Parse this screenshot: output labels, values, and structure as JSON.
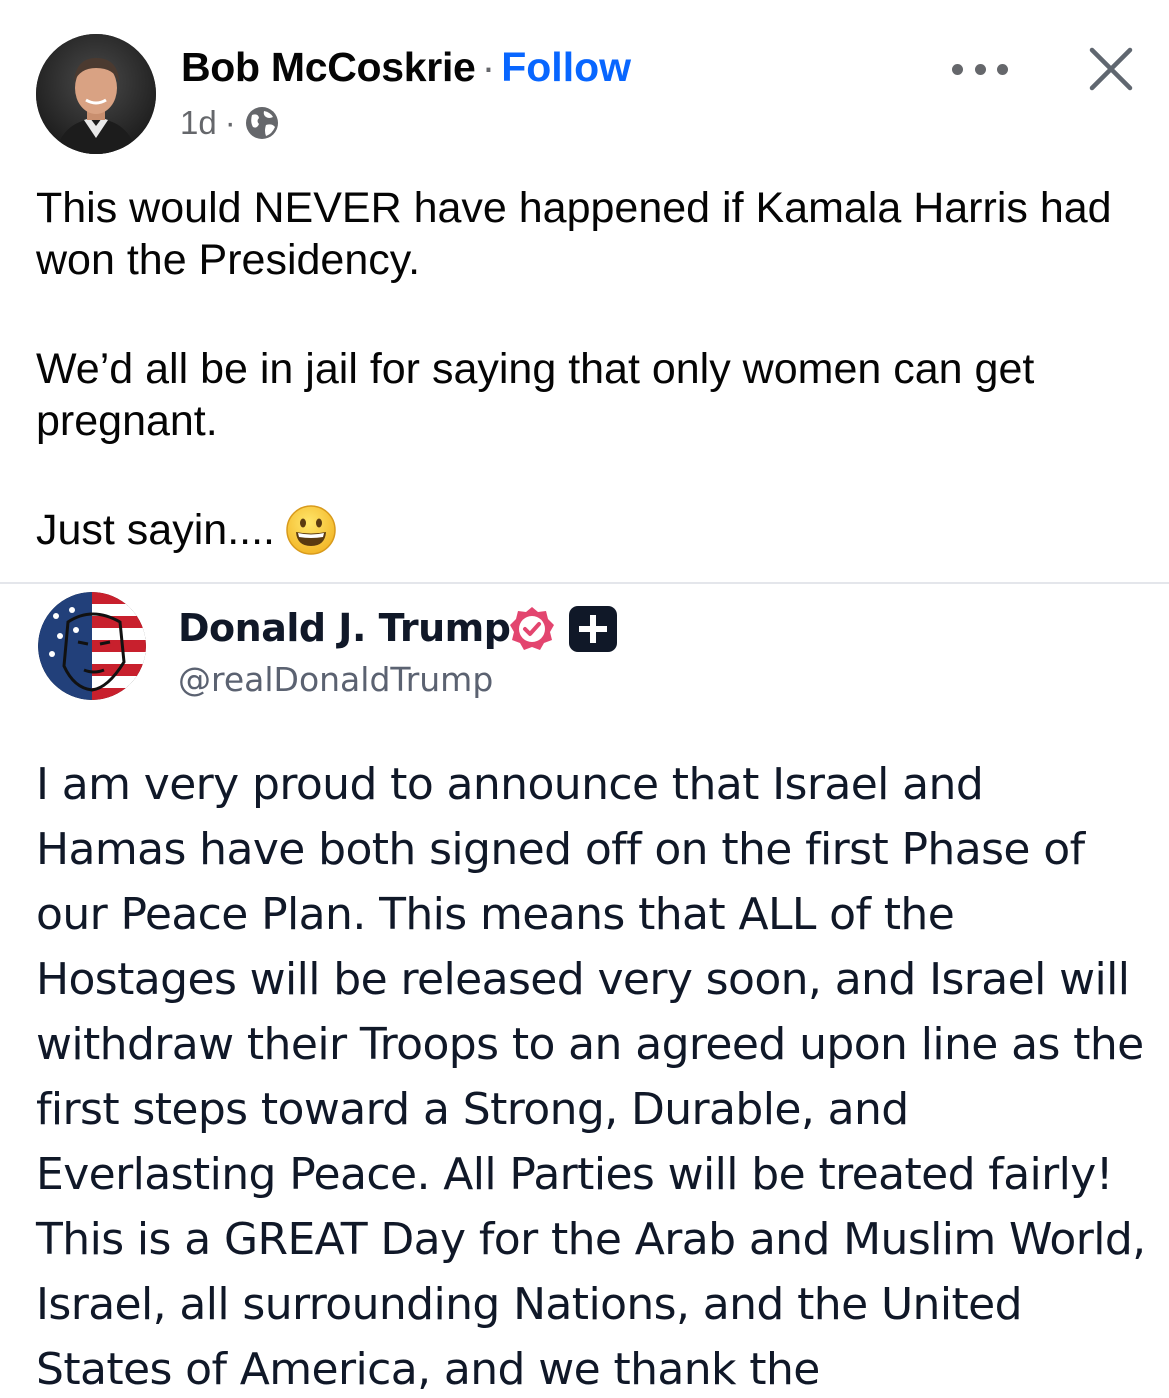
{
  "post": {
    "author_name": "Bob McCoskrie",
    "separator": "·",
    "follow_label": "Follow",
    "timestamp": "1d",
    "meta_separator": "·",
    "audience_icon": "globe-icon",
    "more_icon": "more-options-icon",
    "close_icon": "close-icon",
    "paragraphs": [
      "This would NEVER have happened if Kamala Harris had won the Presidency.",
      "We’d all be in jail for saying that only women can get pregnant.",
      "Just sayin...."
    ],
    "emoji": "grinning-face-emoji"
  },
  "embedded_post": {
    "author_name": "Donald J. Trump",
    "handle": "@realDonaldTrump",
    "verified_icon": "verified-badge-icon",
    "plus_icon": "plus-badge-icon",
    "text": "I am very proud to announce that Israel and Hamas have both signed off on the first Phase of our Peace Plan. This means that ALL of the Hostages will be released very soon, and Israel will withdraw their Troops to an agreed upon line as the first steps toward a Strong, Durable, and Everlasting Peace. All Parties will be treated fairly! This is a GREAT Day for the Arab and Muslim World, Israel, all surrounding Nations, and the United States of America, and we thank the"
  },
  "colors": {
    "follow": "#0866ff",
    "secondary_text": "#65676b",
    "verified": "#e3456f",
    "plus_badge": "#101828"
  }
}
